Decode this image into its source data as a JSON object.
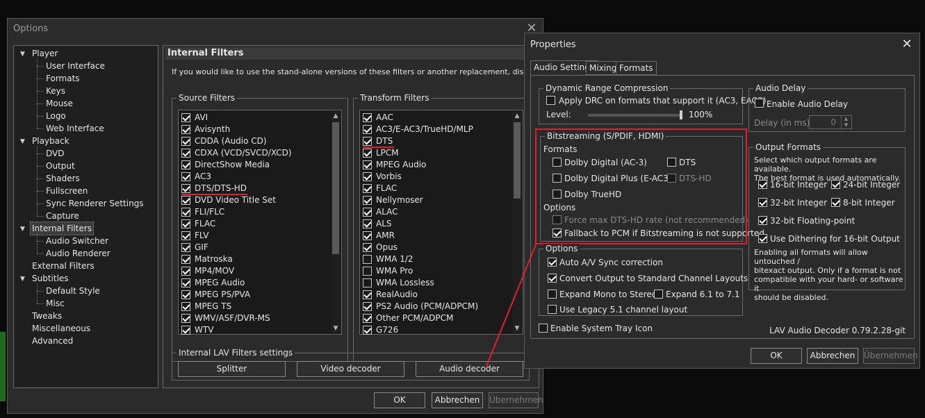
{
  "options": {
    "title": "Options",
    "tree": [
      {
        "label": "Player",
        "level": 0,
        "expanded": true
      },
      {
        "label": "User Interface",
        "level": 1
      },
      {
        "label": "Formats",
        "level": 1
      },
      {
        "label": "Keys",
        "level": 1
      },
      {
        "label": "Mouse",
        "level": 1
      },
      {
        "label": "Logo",
        "level": 1
      },
      {
        "label": "Web Interface",
        "level": 1
      },
      {
        "label": "Playback",
        "level": 0,
        "expanded": true
      },
      {
        "label": "DVD",
        "level": 1
      },
      {
        "label": "Output",
        "level": 1
      },
      {
        "label": "Shaders",
        "level": 1
      },
      {
        "label": "Fullscreen",
        "level": 1
      },
      {
        "label": "Sync Renderer Settings",
        "level": 1
      },
      {
        "label": "Capture",
        "level": 1
      },
      {
        "label": "Internal Filters",
        "level": 0,
        "expanded": true,
        "selected": true
      },
      {
        "label": "Audio Switcher",
        "level": 1
      },
      {
        "label": "Audio Renderer",
        "level": 1
      },
      {
        "label": "External Filters",
        "level": 0
      },
      {
        "label": "Subtitles",
        "level": 0,
        "expanded": true
      },
      {
        "label": "Default Style",
        "level": 1
      },
      {
        "label": "Misc",
        "level": 1
      },
      {
        "label": "Tweaks",
        "level": 0
      },
      {
        "label": "Miscellaneous",
        "level": 0
      },
      {
        "label": "Advanced",
        "level": 0
      }
    ],
    "page_title": "Internal Filters",
    "description": "If you would like to use the stand-alone versions of these filters or another replacement, disable them here.",
    "source_filters_label": "Source Filters",
    "source_filters": [
      {
        "label": "AVI",
        "checked": true
      },
      {
        "label": "Avisynth",
        "checked": true
      },
      {
        "label": "CDDA (Audio CD)",
        "checked": true
      },
      {
        "label": "CDXA (VCD/SVCD/XCD)",
        "checked": true
      },
      {
        "label": "DirectShow Media",
        "checked": true
      },
      {
        "label": "AC3",
        "checked": true
      },
      {
        "label": "DTS/DTS-HD",
        "checked": true,
        "highlight": true
      },
      {
        "label": "DVD Video Title Set",
        "checked": true
      },
      {
        "label": "FLI/FLC",
        "checked": true
      },
      {
        "label": "FLAC",
        "checked": true
      },
      {
        "label": "FLV",
        "checked": true
      },
      {
        "label": "GIF",
        "checked": true
      },
      {
        "label": "Matroska",
        "checked": true
      },
      {
        "label": "MP4/MOV",
        "checked": true
      },
      {
        "label": "MPEG Audio",
        "checked": true
      },
      {
        "label": "MPEG PS/PVA",
        "checked": true
      },
      {
        "label": "MPEG TS",
        "checked": true
      },
      {
        "label": "WMV/ASF/DVR-MS",
        "checked": true
      },
      {
        "label": "WTV",
        "checked": true
      }
    ],
    "transform_filters_label": "Transform Filters",
    "transform_filters": [
      {
        "label": "AAC",
        "checked": true
      },
      {
        "label": "AC3/E-AC3/TrueHD/MLP",
        "checked": true
      },
      {
        "label": "DTS",
        "checked": true,
        "highlight": true
      },
      {
        "label": "LPCM",
        "checked": true
      },
      {
        "label": "MPEG Audio",
        "checked": true
      },
      {
        "label": "Vorbis",
        "checked": true
      },
      {
        "label": "FLAC",
        "checked": true
      },
      {
        "label": "Nellymoser",
        "checked": true
      },
      {
        "label": "ALAC",
        "checked": true
      },
      {
        "label": "ALS",
        "checked": true
      },
      {
        "label": "AMR",
        "checked": true
      },
      {
        "label": "Opus",
        "checked": true
      },
      {
        "label": "WMA 1/2",
        "checked": false
      },
      {
        "label": "WMA Pro",
        "checked": false
      },
      {
        "label": "WMA Lossless",
        "checked": false
      },
      {
        "label": "RealAudio",
        "checked": true
      },
      {
        "label": "PS2 Audio (PCM/ADPCM)",
        "checked": true
      },
      {
        "label": "Other PCM/ADPCM",
        "checked": true
      },
      {
        "label": "G726",
        "checked": true
      }
    ],
    "lav_label": "Internal LAV Filters settings",
    "lav_buttons": {
      "splitter": "Splitter",
      "video": "Video decoder",
      "audio": "Audio decoder"
    },
    "buttons": {
      "ok": "OK",
      "cancel": "Abbrechen",
      "apply": "Übernehmen"
    }
  },
  "properties": {
    "title": "Properties",
    "tabs": [
      "Audio Settings",
      "Mixing",
      "Formats"
    ],
    "drc": {
      "label": "Dynamic Range Compression",
      "apply_label": "Apply DRC on formats that support it (AC3, EAC3)",
      "apply_checked": false,
      "level_label": "Level:",
      "level_value": "100%",
      "level_fraction": 1.0
    },
    "delay": {
      "label": "Audio Delay",
      "enable_label": "Enable Audio Delay",
      "enable_checked": false,
      "delay_label": "Delay (in ms):",
      "delay_value": "0"
    },
    "bitstream": {
      "label": "Bitstreaming (S/PDIF, HDMI)",
      "formats_label": "Formats",
      "ac3": {
        "label": "Dolby Digital (AC-3)",
        "checked": false
      },
      "dts": {
        "label": "DTS",
        "checked": false
      },
      "eac3": {
        "label": "Dolby Digital Plus (E-AC3)",
        "checked": false
      },
      "dtshd": {
        "label": "DTS-HD",
        "checked": false
      },
      "truehd": {
        "label": "Dolby TrueHD",
        "checked": false
      },
      "options_label": "Options",
      "force": {
        "label": "Force max DTS-HD rate (not recommended)",
        "checked": false
      },
      "fallback": {
        "label": "Fallback to PCM if Bitstreaming is not supported",
        "checked": true
      }
    },
    "output_formats": {
      "label": "Output Formats",
      "desc": "Select which output formats are available.\nThe best format is used automatically.",
      "int16": {
        "label": "16-bit Integer",
        "checked": true
      },
      "int24": {
        "label": "24-bit Integer",
        "checked": true
      },
      "int32": {
        "label": "32-bit Integer",
        "checked": true
      },
      "int8": {
        "label": "8-bit Integer",
        "checked": true
      },
      "float32": {
        "label": "32-bit Floating-point",
        "checked": true
      },
      "dither": {
        "label": "Use Dithering for 16-bit Output",
        "checked": true
      },
      "note": "Enabling all formats will allow untouched /\nbitexact output. Only if a format is not\ncompatible with your hard- or software it\nshould be disabled."
    },
    "options": {
      "label": "Options",
      "avsync": {
        "label": "Auto A/V Sync correction",
        "checked": true
      },
      "convert": {
        "label": "Convert Output to Standard Channel Layouts",
        "checked": true
      },
      "mono": {
        "label": "Expand Mono to Stereo",
        "checked": false
      },
      "expand61": {
        "label": "Expand 6.1 to 7.1",
        "checked": false
      },
      "legacy": {
        "label": "Use Legacy 5.1 channel layout",
        "checked": false
      }
    },
    "tray": {
      "label": "Enable System Tray Icon",
      "checked": false
    },
    "version": "LAV Audio Decoder 0.79.2.28-git",
    "buttons": {
      "ok": "OK",
      "cancel": "Abbrechen",
      "apply": "Übernehmen"
    }
  },
  "colors": {
    "highlight": "#e0202a",
    "background": "#2b2b2b"
  }
}
